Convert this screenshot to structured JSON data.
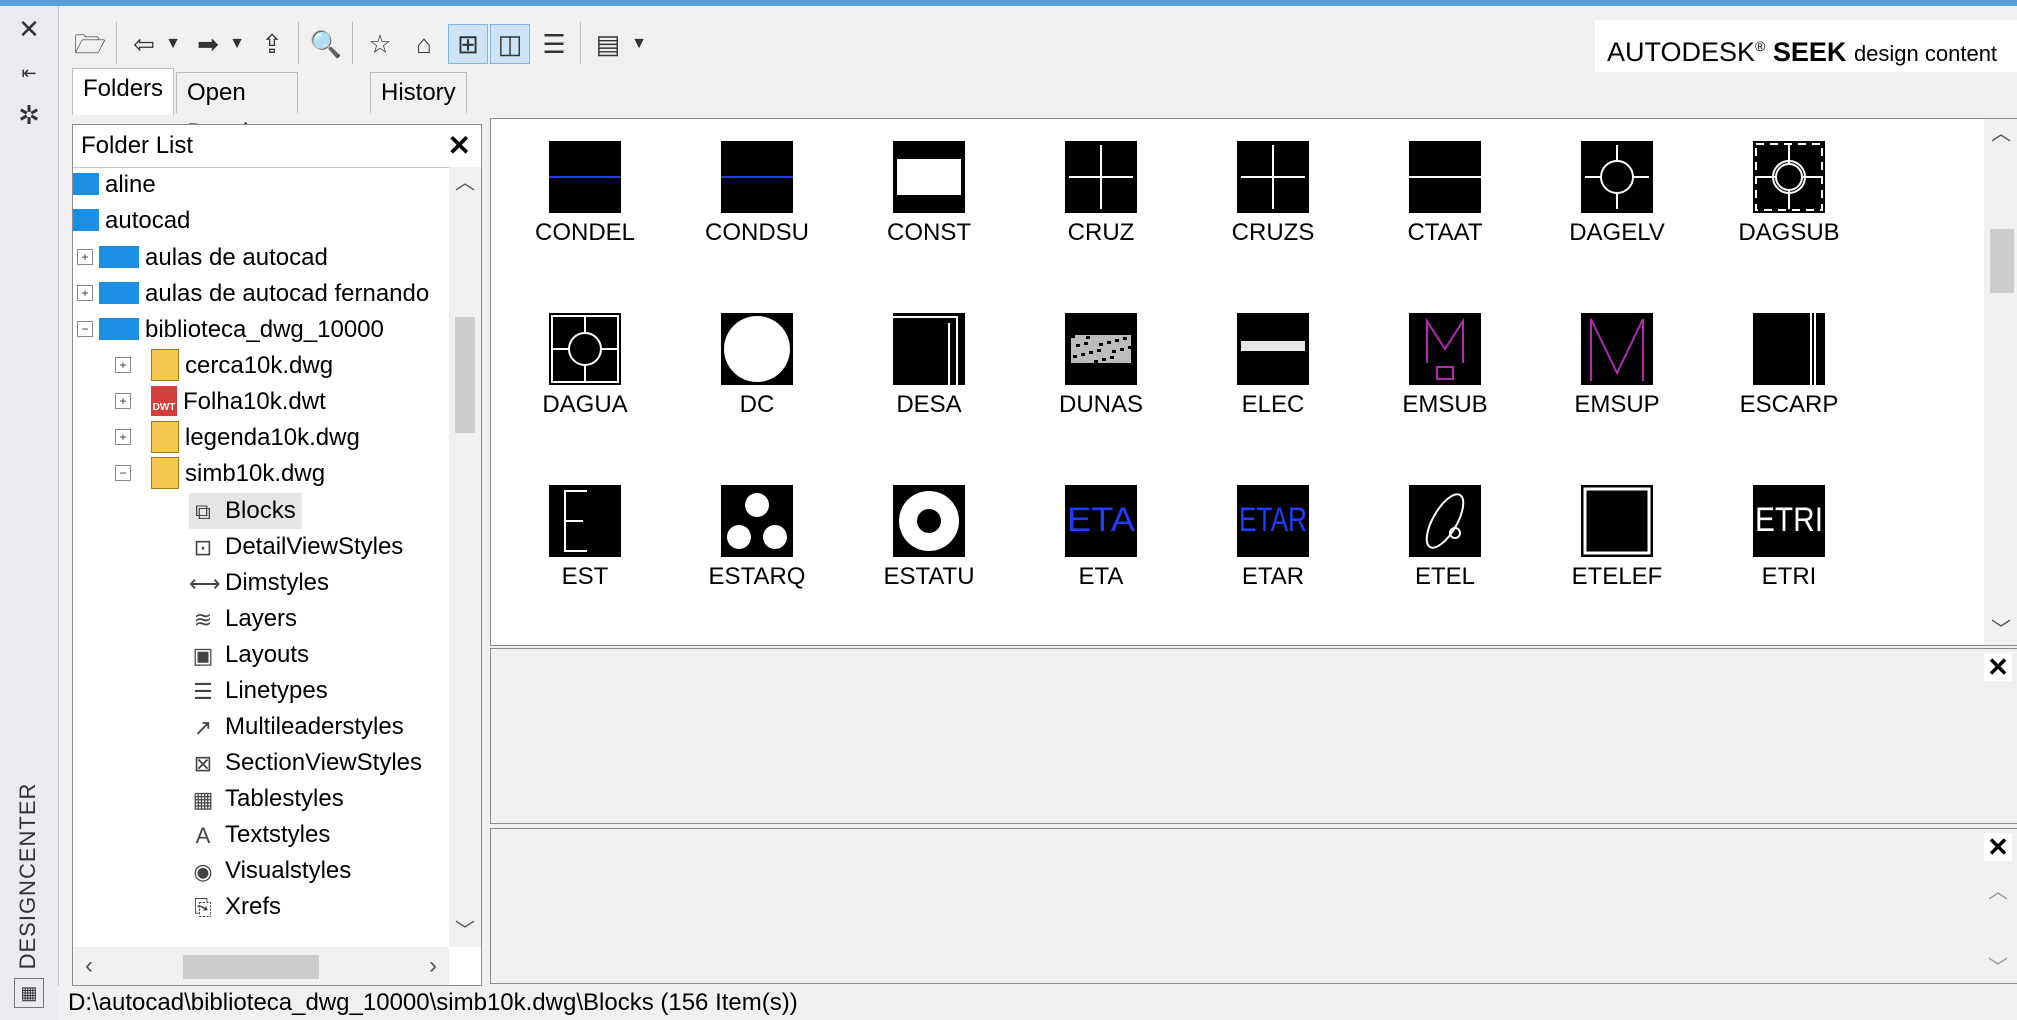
{
  "window": {
    "side_title": "DESIGNCENTER"
  },
  "toolbar": {
    "seek_brand": "AUTODESK",
    "seek_reg": "®",
    "seek_bold": "SEEK",
    "seek_rest": "design content"
  },
  "tabs": [
    {
      "label": "Folders"
    },
    {
      "label": "Open Drawings"
    },
    {
      "label": "History"
    }
  ],
  "folder_list": {
    "title": "Folder List",
    "nodes": [
      {
        "label": "aline"
      },
      {
        "label": "autocad"
      },
      {
        "label": "aulas de autocad"
      },
      {
        "label": "aulas de autocad fernando"
      },
      {
        "label": "biblioteca_dwg_10000"
      },
      {
        "label": "cerca10k.dwg"
      },
      {
        "label": "Folha10k.dwt"
      },
      {
        "label": "legenda10k.dwg"
      },
      {
        "label": "simb10k.dwg"
      },
      {
        "label": "Blocks"
      },
      {
        "label": "DetailViewStyles"
      },
      {
        "label": "Dimstyles"
      },
      {
        "label": "Layers"
      },
      {
        "label": "Layouts"
      },
      {
        "label": "Linetypes"
      },
      {
        "label": "Multileaderstyles"
      },
      {
        "label": "SectionViewStyles"
      },
      {
        "label": "Tablestyles"
      },
      {
        "label": "Textstyles"
      },
      {
        "label": "Visualstyles"
      },
      {
        "label": "Xrefs"
      }
    ]
  },
  "blocks": [
    {
      "label": "CONDEL"
    },
    {
      "label": "CONDSU"
    },
    {
      "label": "CONST"
    },
    {
      "label": "CRUZ"
    },
    {
      "label": "CRUZS"
    },
    {
      "label": "CTAAT"
    },
    {
      "label": "DAGELV"
    },
    {
      "label": "DAGSUB"
    },
    {
      "label": "DAGUA"
    },
    {
      "label": "DC"
    },
    {
      "label": "DESA"
    },
    {
      "label": "DUNAS"
    },
    {
      "label": "ELEC"
    },
    {
      "label": "EMSUB"
    },
    {
      "label": "EMSUP"
    },
    {
      "label": "ESCARP"
    },
    {
      "label": "EST"
    },
    {
      "label": "ESTARQ"
    },
    {
      "label": "ESTATU"
    },
    {
      "label": "ETA",
      "glyph": "ETA"
    },
    {
      "label": "ETAR",
      "glyph": "ETAR"
    },
    {
      "label": "ETEL"
    },
    {
      "label": "ETELEF"
    },
    {
      "label": "ETRI",
      "glyph": "ETRI"
    }
  ],
  "status": {
    "path": "D:\\autocad\\biblioteca_dwg_10000\\simb10k.dwg\\Blocks (156 Item(s))"
  }
}
